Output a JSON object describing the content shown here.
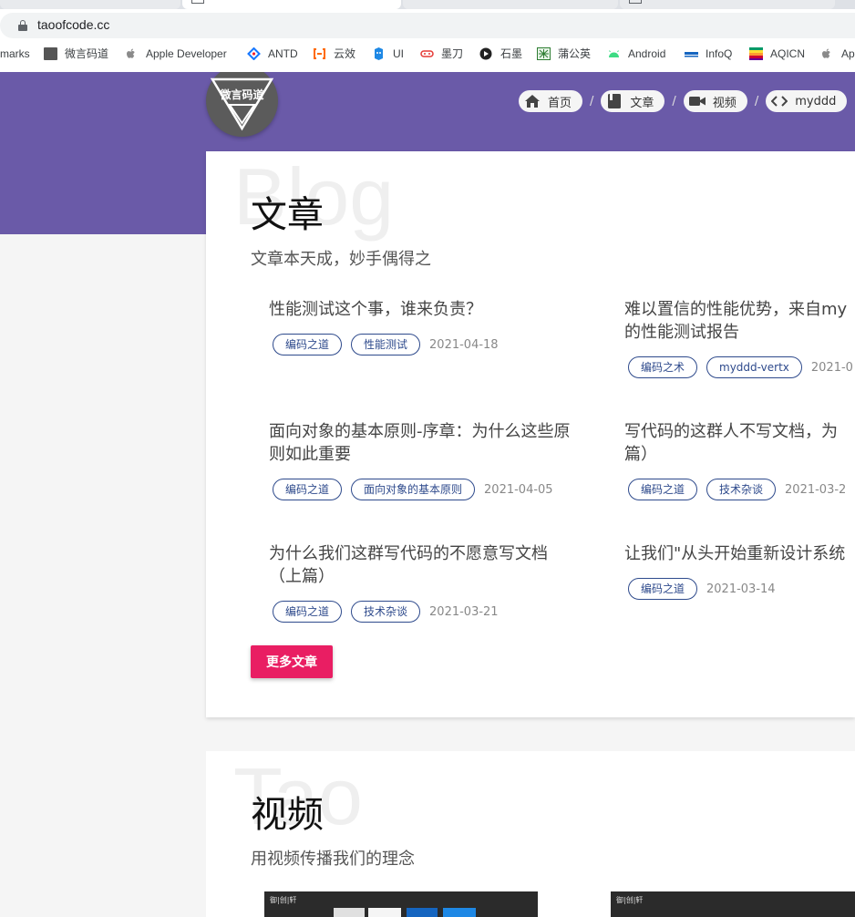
{
  "browser": {
    "url": "taoofcode.cc",
    "bookmarks": [
      {
        "label": "marks",
        "icon": "none"
      },
      {
        "label": "微言码道",
        "icon": "site-favicon"
      },
      {
        "label": "Apple Developer",
        "icon": "apple-icon"
      },
      {
        "label": "ANTD",
        "icon": "antd-icon"
      },
      {
        "label": "云效",
        "icon": "aliyun-icon"
      },
      {
        "label": "UI",
        "icon": "ui-icon"
      },
      {
        "label": "墨刀",
        "icon": "modao-icon"
      },
      {
        "label": "石墨",
        "icon": "shimo-icon"
      },
      {
        "label": "蒲公英",
        "icon": "pgyer-icon"
      },
      {
        "label": "Android",
        "icon": "android-icon"
      },
      {
        "label": "InfoQ",
        "icon": "infoq-icon"
      },
      {
        "label": "AQICN",
        "icon": "aqicn-icon"
      },
      {
        "label": "Ap",
        "icon": "apple-icon"
      }
    ]
  },
  "header": {
    "logo_text": "微言码道",
    "nav": [
      {
        "label": "首页",
        "icon": "home-icon"
      },
      {
        "label": "文章",
        "icon": "book-icon"
      },
      {
        "label": "视频",
        "icon": "video-icon"
      },
      {
        "label": "myddd",
        "icon": "code-icon"
      }
    ],
    "separator": "/"
  },
  "articles_section": {
    "ghost_text": "Blog",
    "title": "文章",
    "subtitle": "文章本天成，妙手偶得之",
    "articles": [
      {
        "title_lines": [
          "性能测试这个事，谁来负责？"
        ],
        "tags": [
          "编码之道",
          "性能测试"
        ],
        "date": "2021-04-18"
      },
      {
        "title_lines": [
          "难以置信的性能优势，来自my",
          "的性能测试报告"
        ],
        "tags": [
          "编码之术",
          "myddd-vertx"
        ],
        "date": "2021-0"
      },
      {
        "title_lines": [
          "面向对象的基本原则-序章：为什么这些原",
          "则如此重要"
        ],
        "tags": [
          "编码之道",
          "面向对象的基本原则"
        ],
        "date": "2021-04-05"
      },
      {
        "title_lines": [
          "写代码的这群人不写文档，为",
          "篇）"
        ],
        "tags": [
          "编码之道",
          "技术杂谈"
        ],
        "date": "2021-03-2"
      },
      {
        "title_lines": [
          "为什么我们这群写代码的不愿意写文档",
          "（上篇）"
        ],
        "tags": [
          "编码之道",
          "技术杂谈"
        ],
        "date": "2021-03-21"
      },
      {
        "title_lines": [
          "让我们\"从头开始重新设计系统"
        ],
        "tags": [
          "编码之道"
        ],
        "date": "2021-03-14"
      }
    ],
    "more_button": "更多文章"
  },
  "videos_section": {
    "ghost_text": "Tao",
    "title": "视频",
    "subtitle": "用视频传播我们的理念",
    "thumb_labels": [
      "御|创|轩",
      "御|创|轩"
    ]
  },
  "colors": {
    "header_band": "#6a5aa8",
    "tag_border": "#2e4a8c",
    "more_button": "#e91e63"
  }
}
